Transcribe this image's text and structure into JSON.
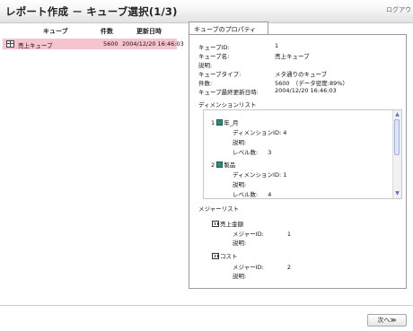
{
  "header": {
    "title": "レポート作成 － キューブ選択(1/3)",
    "logout_label": "ログアウ"
  },
  "cube_list": {
    "columns": [
      "キューブ",
      "件数",
      "更新日時"
    ],
    "rows": [
      {
        "name": "売上キューブ",
        "count": "5600",
        "updated": "2004/12/20 16:46:03"
      }
    ],
    "selected_color": "#f5c5cf"
  },
  "properties": {
    "tab_label": "キューブのプロパティ",
    "fields": [
      {
        "label": "キューブID:",
        "value": "1"
      },
      {
        "label": "キューブ名:",
        "value": "売上キューブ"
      },
      {
        "label": "説明:",
        "value": ""
      },
      {
        "label": "キューブタイプ:",
        "value": "メタ通りのキューブ"
      },
      {
        "label": "件数:",
        "value": "5600　（データ密度:89%）"
      },
      {
        "label": "キューブ最終更新日時:",
        "value": "2004/12/20 16:46:03"
      }
    ],
    "dimension_list_label": "ディメンションリスト",
    "dimensions": [
      {
        "index": "1",
        "name": "年_月",
        "id_label": "ディメンションID:",
        "id": "4",
        "desc_label": "説明:",
        "level_label": "レベル数:",
        "levels": "3"
      },
      {
        "index": "2",
        "name": "製品",
        "id_label": "ディメンションID:",
        "id": "1",
        "desc_label": "説明:",
        "level_label": "レベル数:",
        "levels": "4"
      }
    ],
    "ellipsis": "・・",
    "measure_list_label": "メジャーリスト",
    "measures": [
      {
        "name": "売上金額",
        "id_label": "メジャーID:",
        "id": "1",
        "desc_label": "説明:"
      },
      {
        "name": "コスト",
        "id_label": "メジャーID:",
        "id": "2",
        "desc_label": "説明:"
      }
    ]
  },
  "footer": {
    "next_label": "次へ≫"
  }
}
